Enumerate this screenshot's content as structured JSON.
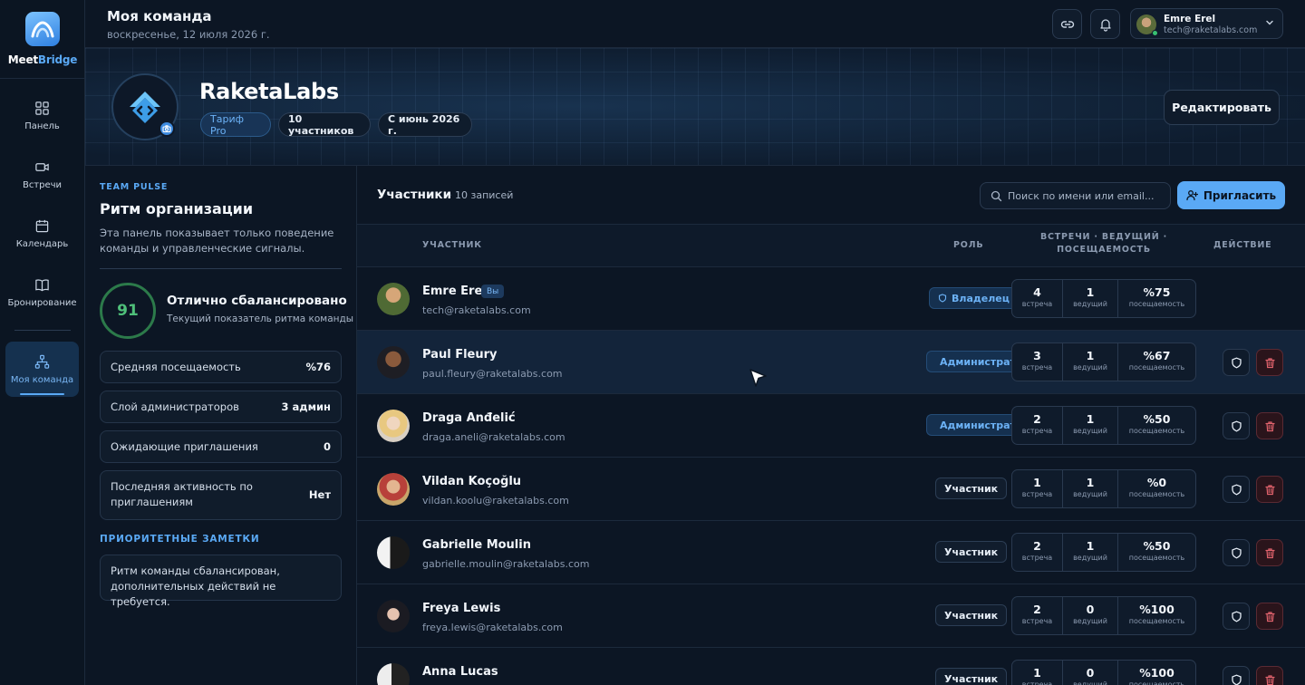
{
  "brand": {
    "part1": "Meet",
    "part2": "Bridge"
  },
  "nav": [
    {
      "label": "Панель",
      "icon": "grid-icon"
    },
    {
      "label": "Встречи",
      "icon": "video-icon"
    },
    {
      "label": "Календарь",
      "icon": "calendar-icon"
    },
    {
      "label": "Бронирование",
      "icon": "book-icon"
    },
    {
      "label": "Моя команда",
      "icon": "team-icon",
      "active": true
    }
  ],
  "header": {
    "title": "Моя команда",
    "date": "воскресенье, 12 июля 2026 г.",
    "user": {
      "name": "Emre Erel",
      "email": "tech@raketalabs.com"
    }
  },
  "banner": {
    "team_name": "RaketaLabs",
    "pills": [
      "Тариф Pro",
      "10 участников",
      "С июнь 2026 г."
    ],
    "edit_label": "Редактировать"
  },
  "pulse": {
    "kicker": "TEAM PULSE",
    "title": "Ритм организации",
    "description": "Эта панель показывает только поведение команды и управленческие сигналы.",
    "score": "91",
    "score_title": "Отлично сбалансировано",
    "score_subtitle": "Текущий показатель ритма команды",
    "stats": [
      {
        "label": "Средняя посещаемость",
        "value": "%76"
      },
      {
        "label": "Слой администраторов",
        "value": "3 админ"
      },
      {
        "label": "Ожидающие приглашения",
        "value": "0"
      },
      {
        "label": "Последняя активность по приглашениям",
        "value": "Нет"
      }
    ],
    "notes_kicker": "ПРИОРИТЕТНЫЕ ЗАМЕТКИ",
    "note": "Ритм команды сбалансирован, дополнительных действий не требуется."
  },
  "members": {
    "title": "Участники",
    "count": "· 10 записей",
    "search_placeholder": "Поиск по имени или email...",
    "invite_label": "Пригласить",
    "columns": {
      "member": "УЧАСТНИК",
      "role": "РОЛЬ",
      "stats_line1": "ВСТРЕЧИ · ВЕДУЩИЙ ·",
      "stats_line2": "ПОСЕЩАЕМОСТЬ",
      "action": "ДЕЙСТВИЕ"
    },
    "metric_labels": {
      "meetings": "встреча",
      "host": "ведущий",
      "attendance": "посещаемость"
    },
    "you_badge": "Вы",
    "rows": [
      {
        "name": "Emre Erel",
        "email": "tech@raketalabs.com",
        "role": "Владелец",
        "meetings": "4",
        "host": "1",
        "attendance": "%75"
      },
      {
        "name": "Paul Fleury",
        "email": "paul.fleury@raketalabs.com",
        "role": "Администратор",
        "meetings": "3",
        "host": "1",
        "attendance": "%67"
      },
      {
        "name": "Draga Anđelić",
        "email": "draga.aneli@raketalabs.com",
        "role": "Администратор",
        "meetings": "2",
        "host": "1",
        "attendance": "%50"
      },
      {
        "name": "Vildan Koçoğlu",
        "email": "vildan.koolu@raketalabs.com",
        "role": "Участник",
        "meetings": "1",
        "host": "1",
        "attendance": "%0"
      },
      {
        "name": "Gabrielle Moulin",
        "email": "gabrielle.moulin@raketalabs.com",
        "role": "Участник",
        "meetings": "2",
        "host": "1",
        "attendance": "%50"
      },
      {
        "name": "Freya Lewis",
        "email": "freya.lewis@raketalabs.com",
        "role": "Участник",
        "meetings": "2",
        "host": "0",
        "attendance": "%100"
      },
      {
        "name": "Anna Lucas",
        "email": "",
        "role": "Участник",
        "meetings": "1",
        "host": "0",
        "attendance": "%100"
      }
    ]
  }
}
